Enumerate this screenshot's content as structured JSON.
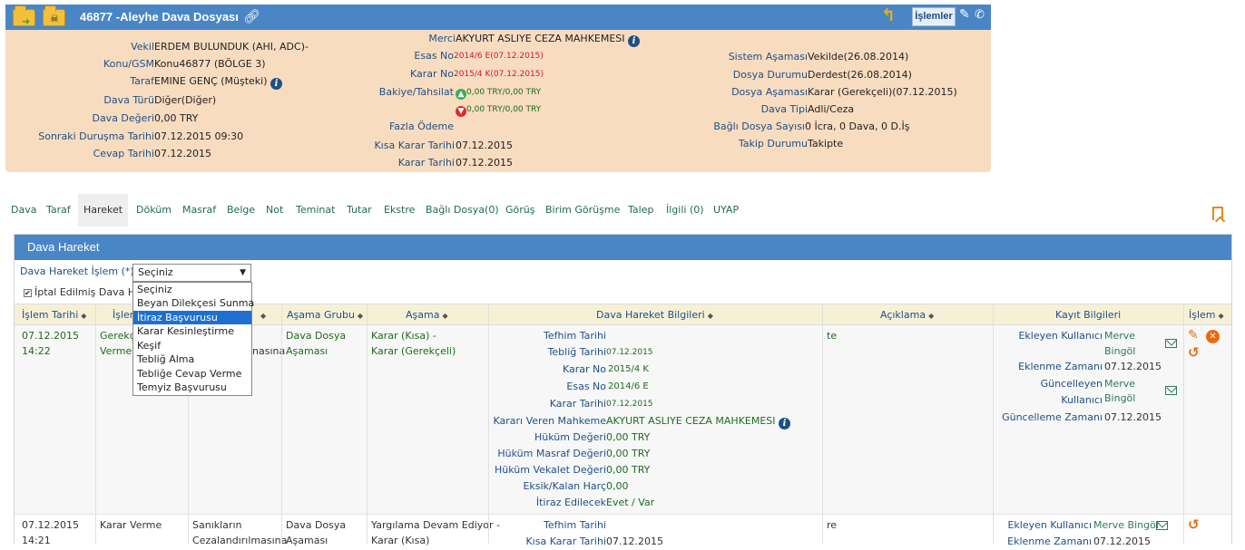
{
  "case": {
    "title": "46877 -Aleyhe Dava Dosyası",
    "islemler_label": "İşlemler",
    "left": [
      {
        "label": "Vekil",
        "value": "ERDEM BULUNDUK (AHI, ADC)-"
      },
      {
        "label": "Konu/GSM",
        "value": "Konu46877 (BÖLGE 3)"
      },
      {
        "label": "Taraf",
        "value": "EMINE GENÇ (Müşteki)"
      },
      {
        "label": "Dava Türü",
        "value": "Diğer(Diğer)"
      },
      {
        "label": "Dava Değeri",
        "value": "0,00 TRY"
      },
      {
        "label": "Sonraki Duruşma Tarihi",
        "value": "07.12.2015 09:30"
      },
      {
        "label": "Cevap Tarihi",
        "value": "07.12.2015"
      }
    ],
    "middle": {
      "merci_label": "Merci",
      "merci_value": "AKYURT ASLIYE CEZA MAHKEMESI",
      "esas_label": "Esas No",
      "esas_value": "2014/6 E(07.12.2015)",
      "karar_label": "Karar No",
      "karar_value": "2015/4 K(07.12.2015)",
      "bakiye_label": "Bakiye/Tahsilat",
      "bakiye_up": "0,00 TRY/0,00 TRY",
      "bakiye_down": "0,00 TRY/0,00 TRY",
      "fazla_label": "Fazla Ödeme",
      "kisa_label": "Kısa Karar Tarihi",
      "kisa_value": "07.12.2015",
      "karar_tarihi_label": "Karar Tarihi",
      "karar_tarihi_value": "07.12.2015"
    },
    "right": [
      {
        "label": "Sistem Aşaması",
        "value": "Vekilde(26.08.2014)"
      },
      {
        "label": "Dosya Durumu",
        "value": "Derdest(26.08.2014)"
      },
      {
        "label": "Dosya Aşaması",
        "value": "Karar (Gerekçeli)(07.12.2015)"
      },
      {
        "label": "Dava Tipi",
        "value": "Adli/Ceza"
      },
      {
        "label": "Bağlı Dosya Sayısı",
        "value": "0 İcra, 0 Dava, 0 D.İş"
      },
      {
        "label": "Takip Durumu",
        "value": "Takipte"
      }
    ]
  },
  "tabs": [
    "Dava",
    "Taraf",
    "Hareket",
    "Döküm",
    "Masraf",
    "Belge",
    "Not",
    "Teminat",
    "Tutar",
    "Ekstre",
    "Bağlı Dosya(0)",
    "Görüş",
    "Birim Görüşme",
    "Talep",
    "İlgili (0)",
    "UYAP"
  ],
  "active_tab": "Hareket",
  "panel": {
    "title": "Dava Hareket",
    "filter_label": "Dava Hareket İşlem (*)",
    "select_value": "Seçiniz",
    "iptal_label": "İptal Edilmiş Dava H",
    "options": [
      "Seçiniz",
      "Beyan Dilekçesi Sunma",
      "İtiraz Başvurusu",
      "Karar Kesinleştirme",
      "Keşif",
      "Tebliğ Alma",
      "Tebliğe Cevap Verme",
      "Temyiz Başvurusu"
    ],
    "highlighted_option": "İtiraz Başvurusu"
  },
  "table": {
    "headers": [
      "İşlem Tarihi",
      "İşlem",
      "",
      "Aşama Grubu",
      "Aşama",
      "Dava Hareket Bilgileri",
      "Açıklama",
      "Kayıt Bilgileri",
      "İşlem"
    ],
    "row1": {
      "date": "07.12.2015",
      "time": "14:22",
      "islem_1": "Gerekç",
      "islem_2": "Verme",
      "col3_frag": "nasına",
      "asama_grubu_1": "Dava Dosya",
      "asama_grubu_2": "Aşaması",
      "asama_1": "Karar (Kısa) -",
      "asama_2": "Karar (Gerekçeli)",
      "info": [
        {
          "k": "Tefhim Tarihi",
          "v": ""
        },
        {
          "k": "Tebliğ Tarihi",
          "v": "07.12.2015"
        },
        {
          "k": "Karar No",
          "v": "2015/4 K"
        },
        {
          "k": "Esas No",
          "v": "2014/6 E"
        },
        {
          "k": "Karar Tarihi",
          "v": "07.12.2015"
        },
        {
          "k": "Kararı Veren Mahkeme",
          "v": "AKYURT ASLIYE CEZA MAHKEMESI"
        },
        {
          "k": "Hüküm Değeri",
          "v": "0,00 TRY"
        },
        {
          "k": "Hüküm Masraf Değeri",
          "v": "0,00 TRY"
        },
        {
          "k": "Hüküm Vekalet Değeri",
          "v": "0,00 TRY"
        },
        {
          "k": "Eksik/Kalan Harç",
          "v": "0,00"
        },
        {
          "k": "İtiraz Edilecek",
          "v": "Evet / Var"
        }
      ],
      "aciklama": "te",
      "ekleyen_label": "Ekleyen Kullanıcı",
      "ekleyen_1": "Merve",
      "ekleyen_2": "Bingöl",
      "eklenme_label": "Eklenme Zamanı",
      "eklenme_value": "07.12.2015",
      "guncelleyen_label_1": "Güncelleyen",
      "guncelleyen_label_2": "Kullanıcı",
      "guncelleyen_1": "Merve",
      "guncelleyen_2": "Bingöl",
      "guncelleme_label": "Güncelleme Zamanı",
      "guncelleme_value": "07.12.2015"
    },
    "row2": {
      "date": "07.12.2015",
      "time": "14:21",
      "islem": "Karar Verme",
      "col3_1": "Sanıkların",
      "col3_2": "Cezalandırılmasına",
      "asama_grubu_1": "Dava Dosya",
      "asama_grubu_2": "Aşaması",
      "asama_1": "Yargılama Devam Ediyor -",
      "asama_2": "Karar (Kısa)",
      "info": [
        {
          "k": "Tefhim Tarihi",
          "v": ""
        },
        {
          "k": "Kısa Karar Tarihi",
          "v": "07.12.2015"
        }
      ],
      "aciklama": "re",
      "ekleyen_label": "Ekleyen Kullanıcı",
      "ekleyen_value": "Merve Bingöl",
      "eklenme_label": "Eklenme Zamanı",
      "eklenme_value": "07.12.2015"
    }
  }
}
